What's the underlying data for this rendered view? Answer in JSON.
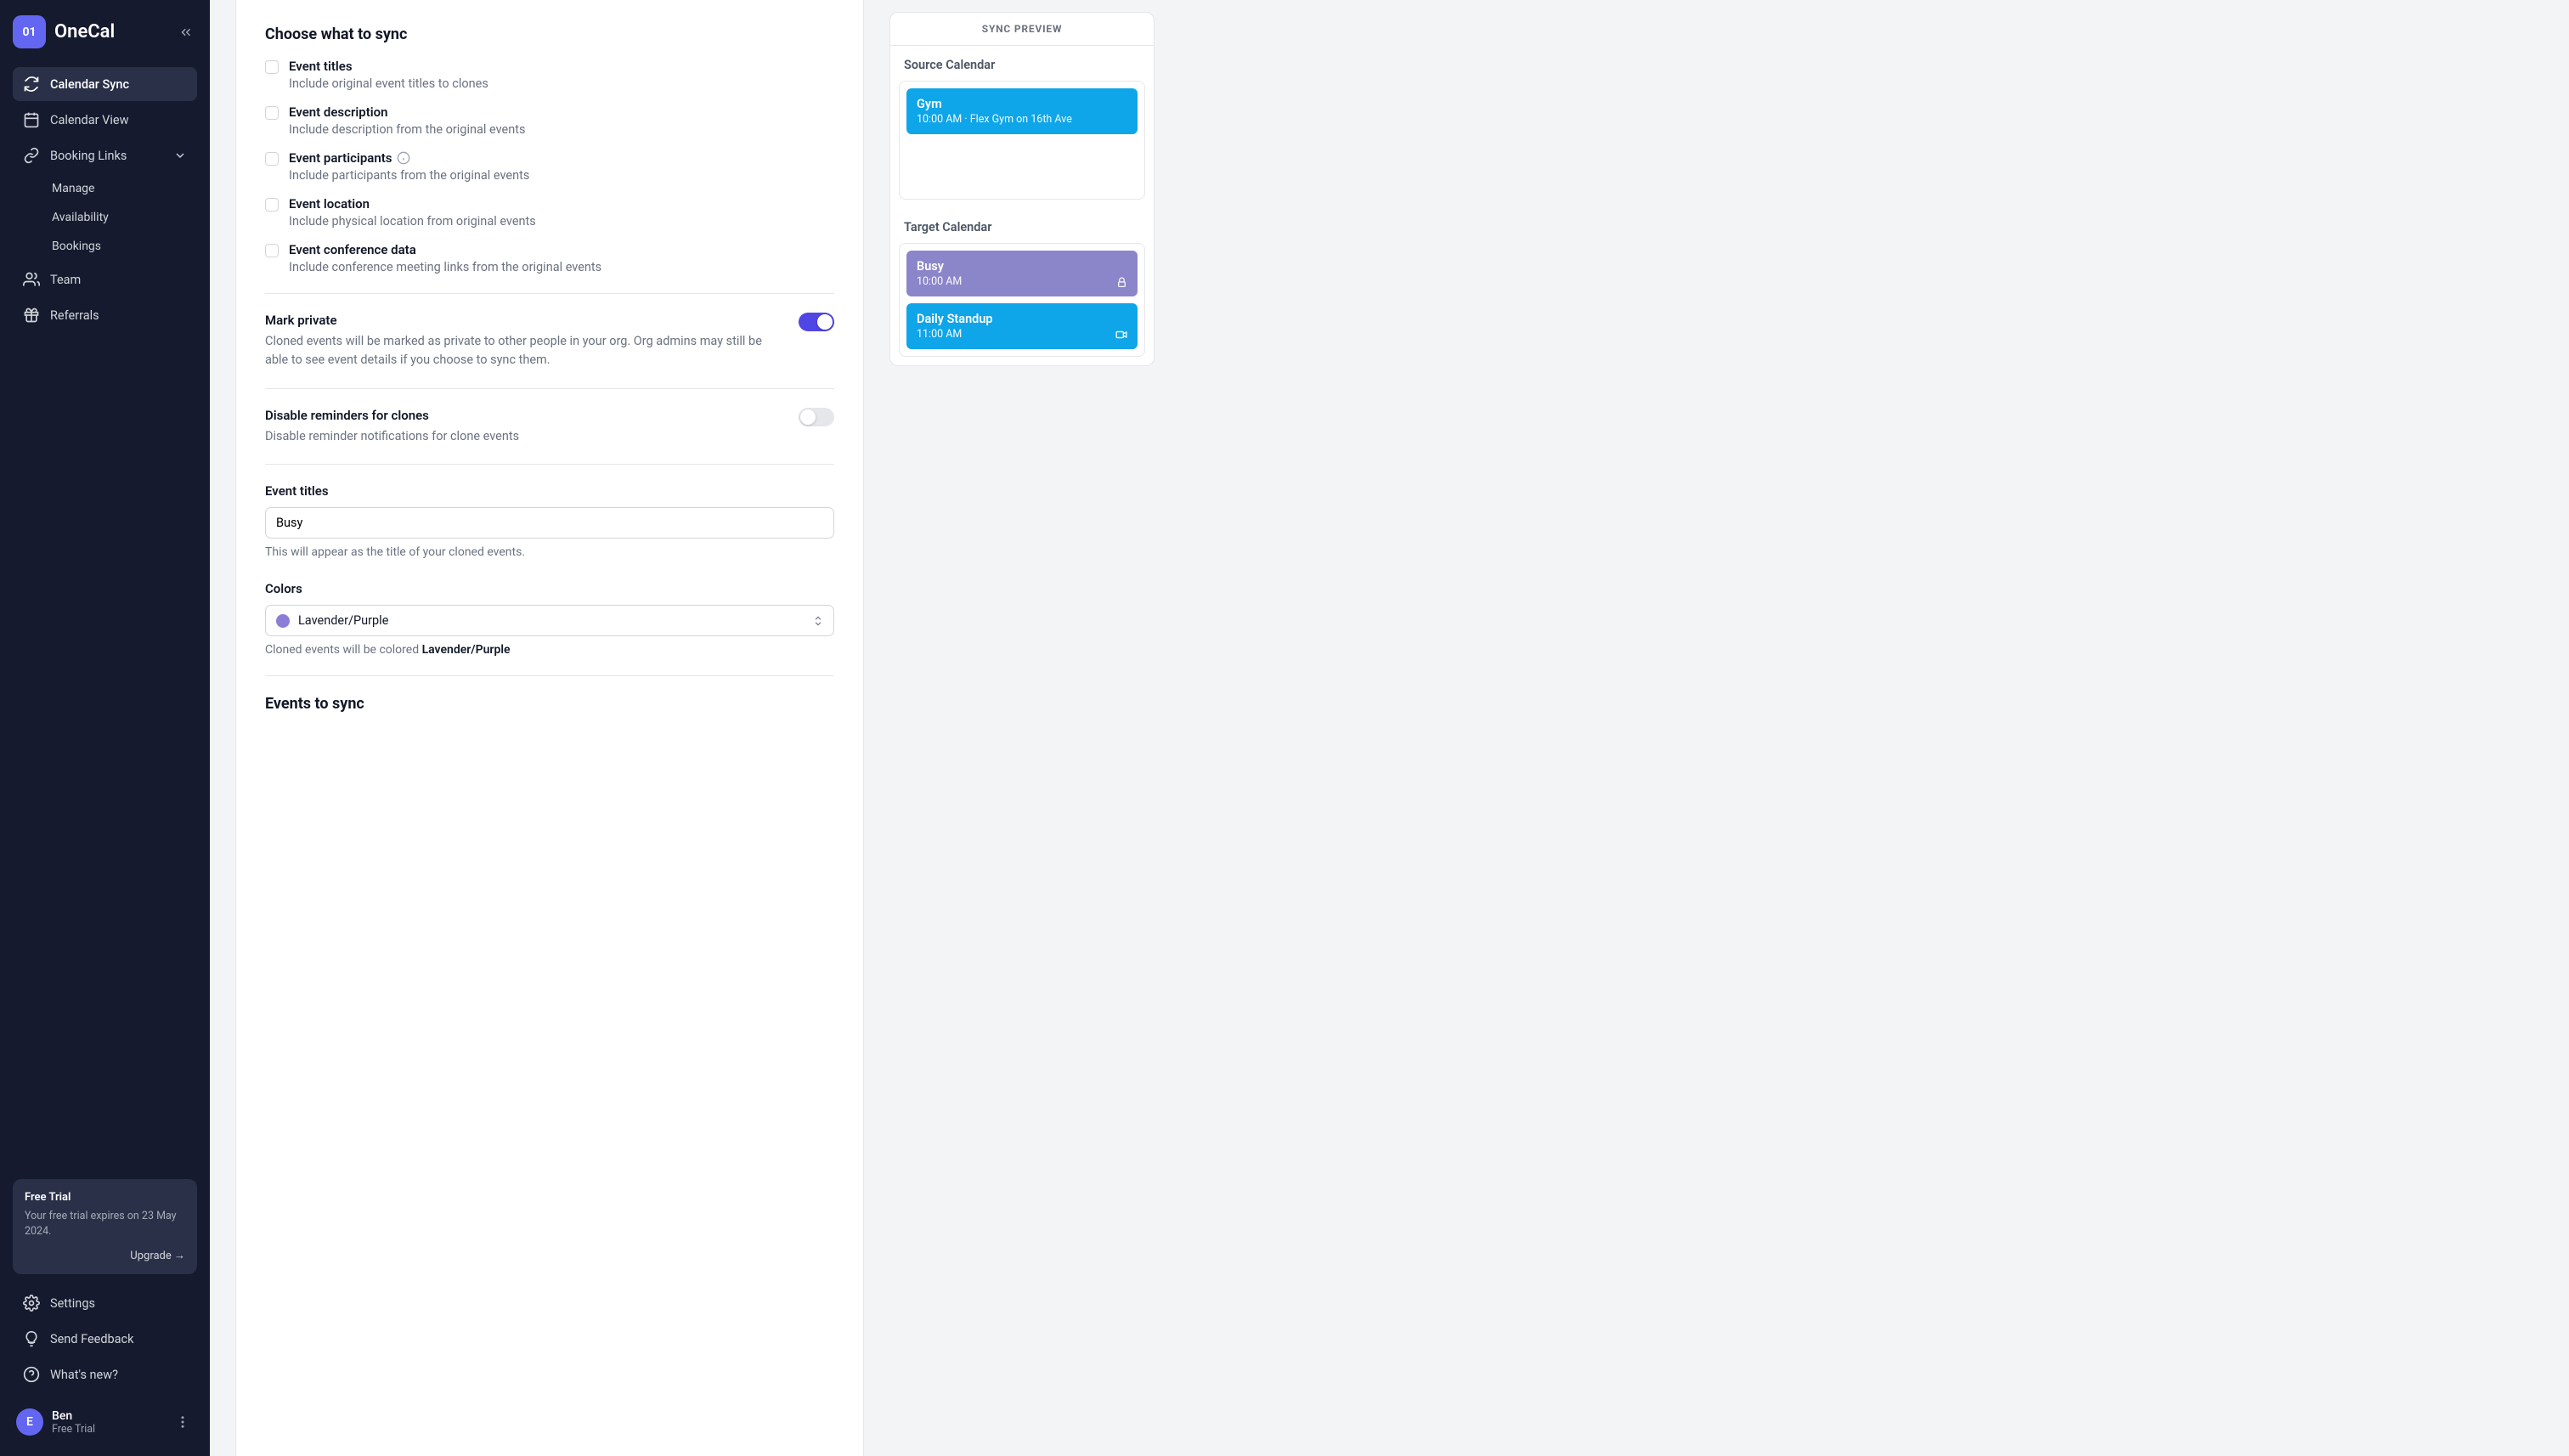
{
  "brand": {
    "logoInitials": "01",
    "name": "OneCal"
  },
  "nav": {
    "main": [
      {
        "label": "Calendar Sync",
        "icon": "sync"
      },
      {
        "label": "Calendar View",
        "icon": "calendar"
      },
      {
        "label": "Booking Links",
        "icon": "link"
      }
    ],
    "bookingSub": [
      {
        "label": "Manage"
      },
      {
        "label": "Availability"
      },
      {
        "label": "Bookings"
      }
    ],
    "secondary": [
      {
        "label": "Team",
        "icon": "team"
      },
      {
        "label": "Referrals",
        "icon": "gift"
      }
    ],
    "bottom": [
      {
        "label": "Settings",
        "icon": "gear"
      },
      {
        "label": "Send Feedback",
        "icon": "bulb"
      },
      {
        "label": "What's new?",
        "icon": "help"
      }
    ]
  },
  "trial": {
    "title": "Free Trial",
    "desc": "Your free trial expires on 23 May 2024.",
    "cta": "Upgrade →"
  },
  "user": {
    "initial": "E",
    "name": "Ben",
    "plan": "Free Trial"
  },
  "sync": {
    "heading": "Choose what to sync",
    "options": [
      {
        "title": "Event titles",
        "desc": "Include original event titles to clones"
      },
      {
        "title": "Event description",
        "desc": "Include description from the original events"
      },
      {
        "title": "Event participants",
        "desc": "Include participants from the original events",
        "info": true
      },
      {
        "title": "Event location",
        "desc": "Include physical location from original events"
      },
      {
        "title": "Event conference data",
        "desc": "Include conference meeting links from the original events"
      }
    ],
    "markPrivate": {
      "title": "Mark private",
      "desc": "Cloned events will be marked as private to other people in your org. Org admins may still be able to see event details if you choose to sync them.",
      "on": true
    },
    "disableReminders": {
      "title": "Disable reminders for clones",
      "desc": "Disable reminder notifications for clone events",
      "on": false
    },
    "eventTitles": {
      "label": "Event titles",
      "value": "Busy",
      "help": "This will appear as the title of your cloned events."
    },
    "colors": {
      "label": "Colors",
      "value": "Lavender/Purple",
      "helpPrefix": "Cloned events will be colored ",
      "helpStrong": "Lavender/Purple"
    },
    "eventsToSyncHeading": "Events to sync"
  },
  "preview": {
    "header": "SYNC PREVIEW",
    "sourceLabel": "Source Calendar",
    "targetLabel": "Target Calendar",
    "sourceEvents": [
      {
        "title": "Gym",
        "sub": "10:00 AM · Flex Gym on 16th Ave",
        "style": "blue"
      }
    ],
    "targetEvents": [
      {
        "title": "Busy",
        "sub": "10:00 AM",
        "style": "purple",
        "icon": "lock"
      },
      {
        "title": "Daily Standup",
        "sub": "11:00 AM",
        "style": "blue",
        "icon": "video"
      }
    ]
  }
}
